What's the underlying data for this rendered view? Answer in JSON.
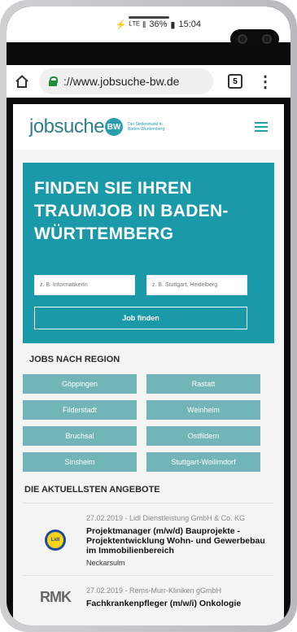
{
  "status_bar": {
    "icons": "⚡ ᴸᵀᴱ ‖",
    "battery": "36%",
    "time": "15:04"
  },
  "browser": {
    "url": "://www.jobsuche-bw.de",
    "tab_count": "5"
  },
  "site": {
    "logo_text": "jobsuche",
    "logo_badge": "BW",
    "logo_tagline": "Der Stellenmarkt in Baden-Württemberg",
    "hero_title": "FINDEN SIE IHREN TRAUMJOB IN BADEN-WÜRTTEMBERG",
    "search_placeholder_job": "z. B. InformatikerIn",
    "search_placeholder_location": "z. B. Stuttgart, Heidelberg",
    "find_button": "Job finden",
    "regions_title": "JOBS NACH REGION",
    "regions": [
      "Göppingen",
      "Rastatt",
      "Filderstadt",
      "Weinheim",
      "Bruchsal",
      "Ostfildern",
      "Sinsheim",
      "Stuttgart-Weilimdorf"
    ],
    "offers_title": "DIE AKTUELLSTEN ANGEBOTE",
    "offers": [
      {
        "meta": "27.02.2019 - Lidl Dienstleistung GmbH & Co. KG",
        "title": "Projektmanager (m/w/d) Bauprojekte - Projektentwicklung Wohn- und Gewerbebau im Immobilienbereich",
        "location": "Neckarsulm",
        "logo": "Lidl"
      },
      {
        "meta": "27.02.2019 - Rems-Murr-Kliniken gGmbH",
        "title": "Fachkrankenpfleger (m/w/i) Onkologie",
        "location": "",
        "logo": "RMK"
      }
    ]
  },
  "colors": {
    "teal": "#1a9aa8",
    "region_button": "#72b5b9"
  }
}
